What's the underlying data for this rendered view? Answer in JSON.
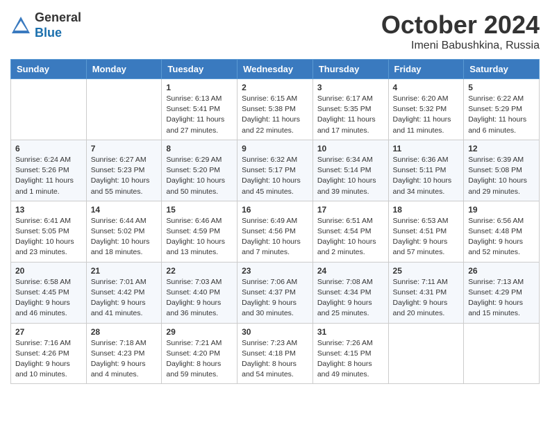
{
  "header": {
    "logo_line1": "General",
    "logo_line2": "Blue",
    "month": "October 2024",
    "location": "Imeni Babushkina, Russia"
  },
  "weekdays": [
    "Sunday",
    "Monday",
    "Tuesday",
    "Wednesday",
    "Thursday",
    "Friday",
    "Saturday"
  ],
  "weeks": [
    [
      {
        "day": "",
        "sunrise": "",
        "sunset": "",
        "daylight": ""
      },
      {
        "day": "",
        "sunrise": "",
        "sunset": "",
        "daylight": ""
      },
      {
        "day": "1",
        "sunrise": "Sunrise: 6:13 AM",
        "sunset": "Sunset: 5:41 PM",
        "daylight": "Daylight: 11 hours and 27 minutes."
      },
      {
        "day": "2",
        "sunrise": "Sunrise: 6:15 AM",
        "sunset": "Sunset: 5:38 PM",
        "daylight": "Daylight: 11 hours and 22 minutes."
      },
      {
        "day": "3",
        "sunrise": "Sunrise: 6:17 AM",
        "sunset": "Sunset: 5:35 PM",
        "daylight": "Daylight: 11 hours and 17 minutes."
      },
      {
        "day": "4",
        "sunrise": "Sunrise: 6:20 AM",
        "sunset": "Sunset: 5:32 PM",
        "daylight": "Daylight: 11 hours and 11 minutes."
      },
      {
        "day": "5",
        "sunrise": "Sunrise: 6:22 AM",
        "sunset": "Sunset: 5:29 PM",
        "daylight": "Daylight: 11 hours and 6 minutes."
      }
    ],
    [
      {
        "day": "6",
        "sunrise": "Sunrise: 6:24 AM",
        "sunset": "Sunset: 5:26 PM",
        "daylight": "Daylight: 11 hours and 1 minute."
      },
      {
        "day": "7",
        "sunrise": "Sunrise: 6:27 AM",
        "sunset": "Sunset: 5:23 PM",
        "daylight": "Daylight: 10 hours and 55 minutes."
      },
      {
        "day": "8",
        "sunrise": "Sunrise: 6:29 AM",
        "sunset": "Sunset: 5:20 PM",
        "daylight": "Daylight: 10 hours and 50 minutes."
      },
      {
        "day": "9",
        "sunrise": "Sunrise: 6:32 AM",
        "sunset": "Sunset: 5:17 PM",
        "daylight": "Daylight: 10 hours and 45 minutes."
      },
      {
        "day": "10",
        "sunrise": "Sunrise: 6:34 AM",
        "sunset": "Sunset: 5:14 PM",
        "daylight": "Daylight: 10 hours and 39 minutes."
      },
      {
        "day": "11",
        "sunrise": "Sunrise: 6:36 AM",
        "sunset": "Sunset: 5:11 PM",
        "daylight": "Daylight: 10 hours and 34 minutes."
      },
      {
        "day": "12",
        "sunrise": "Sunrise: 6:39 AM",
        "sunset": "Sunset: 5:08 PM",
        "daylight": "Daylight: 10 hours and 29 minutes."
      }
    ],
    [
      {
        "day": "13",
        "sunrise": "Sunrise: 6:41 AM",
        "sunset": "Sunset: 5:05 PM",
        "daylight": "Daylight: 10 hours and 23 minutes."
      },
      {
        "day": "14",
        "sunrise": "Sunrise: 6:44 AM",
        "sunset": "Sunset: 5:02 PM",
        "daylight": "Daylight: 10 hours and 18 minutes."
      },
      {
        "day": "15",
        "sunrise": "Sunrise: 6:46 AM",
        "sunset": "Sunset: 4:59 PM",
        "daylight": "Daylight: 10 hours and 13 minutes."
      },
      {
        "day": "16",
        "sunrise": "Sunrise: 6:49 AM",
        "sunset": "Sunset: 4:56 PM",
        "daylight": "Daylight: 10 hours and 7 minutes."
      },
      {
        "day": "17",
        "sunrise": "Sunrise: 6:51 AM",
        "sunset": "Sunset: 4:54 PM",
        "daylight": "Daylight: 10 hours and 2 minutes."
      },
      {
        "day": "18",
        "sunrise": "Sunrise: 6:53 AM",
        "sunset": "Sunset: 4:51 PM",
        "daylight": "Daylight: 9 hours and 57 minutes."
      },
      {
        "day": "19",
        "sunrise": "Sunrise: 6:56 AM",
        "sunset": "Sunset: 4:48 PM",
        "daylight": "Daylight: 9 hours and 52 minutes."
      }
    ],
    [
      {
        "day": "20",
        "sunrise": "Sunrise: 6:58 AM",
        "sunset": "Sunset: 4:45 PM",
        "daylight": "Daylight: 9 hours and 46 minutes."
      },
      {
        "day": "21",
        "sunrise": "Sunrise: 7:01 AM",
        "sunset": "Sunset: 4:42 PM",
        "daylight": "Daylight: 9 hours and 41 minutes."
      },
      {
        "day": "22",
        "sunrise": "Sunrise: 7:03 AM",
        "sunset": "Sunset: 4:40 PM",
        "daylight": "Daylight: 9 hours and 36 minutes."
      },
      {
        "day": "23",
        "sunrise": "Sunrise: 7:06 AM",
        "sunset": "Sunset: 4:37 PM",
        "daylight": "Daylight: 9 hours and 30 minutes."
      },
      {
        "day": "24",
        "sunrise": "Sunrise: 7:08 AM",
        "sunset": "Sunset: 4:34 PM",
        "daylight": "Daylight: 9 hours and 25 minutes."
      },
      {
        "day": "25",
        "sunrise": "Sunrise: 7:11 AM",
        "sunset": "Sunset: 4:31 PM",
        "daylight": "Daylight: 9 hours and 20 minutes."
      },
      {
        "day": "26",
        "sunrise": "Sunrise: 7:13 AM",
        "sunset": "Sunset: 4:29 PM",
        "daylight": "Daylight: 9 hours and 15 minutes."
      }
    ],
    [
      {
        "day": "27",
        "sunrise": "Sunrise: 7:16 AM",
        "sunset": "Sunset: 4:26 PM",
        "daylight": "Daylight: 9 hours and 10 minutes."
      },
      {
        "day": "28",
        "sunrise": "Sunrise: 7:18 AM",
        "sunset": "Sunset: 4:23 PM",
        "daylight": "Daylight: 9 hours and 4 minutes."
      },
      {
        "day": "29",
        "sunrise": "Sunrise: 7:21 AM",
        "sunset": "Sunset: 4:20 PM",
        "daylight": "Daylight: 8 hours and 59 minutes."
      },
      {
        "day": "30",
        "sunrise": "Sunrise: 7:23 AM",
        "sunset": "Sunset: 4:18 PM",
        "daylight": "Daylight: 8 hours and 54 minutes."
      },
      {
        "day": "31",
        "sunrise": "Sunrise: 7:26 AM",
        "sunset": "Sunset: 4:15 PM",
        "daylight": "Daylight: 8 hours and 49 minutes."
      },
      {
        "day": "",
        "sunrise": "",
        "sunset": "",
        "daylight": ""
      },
      {
        "day": "",
        "sunrise": "",
        "sunset": "",
        "daylight": ""
      }
    ]
  ]
}
